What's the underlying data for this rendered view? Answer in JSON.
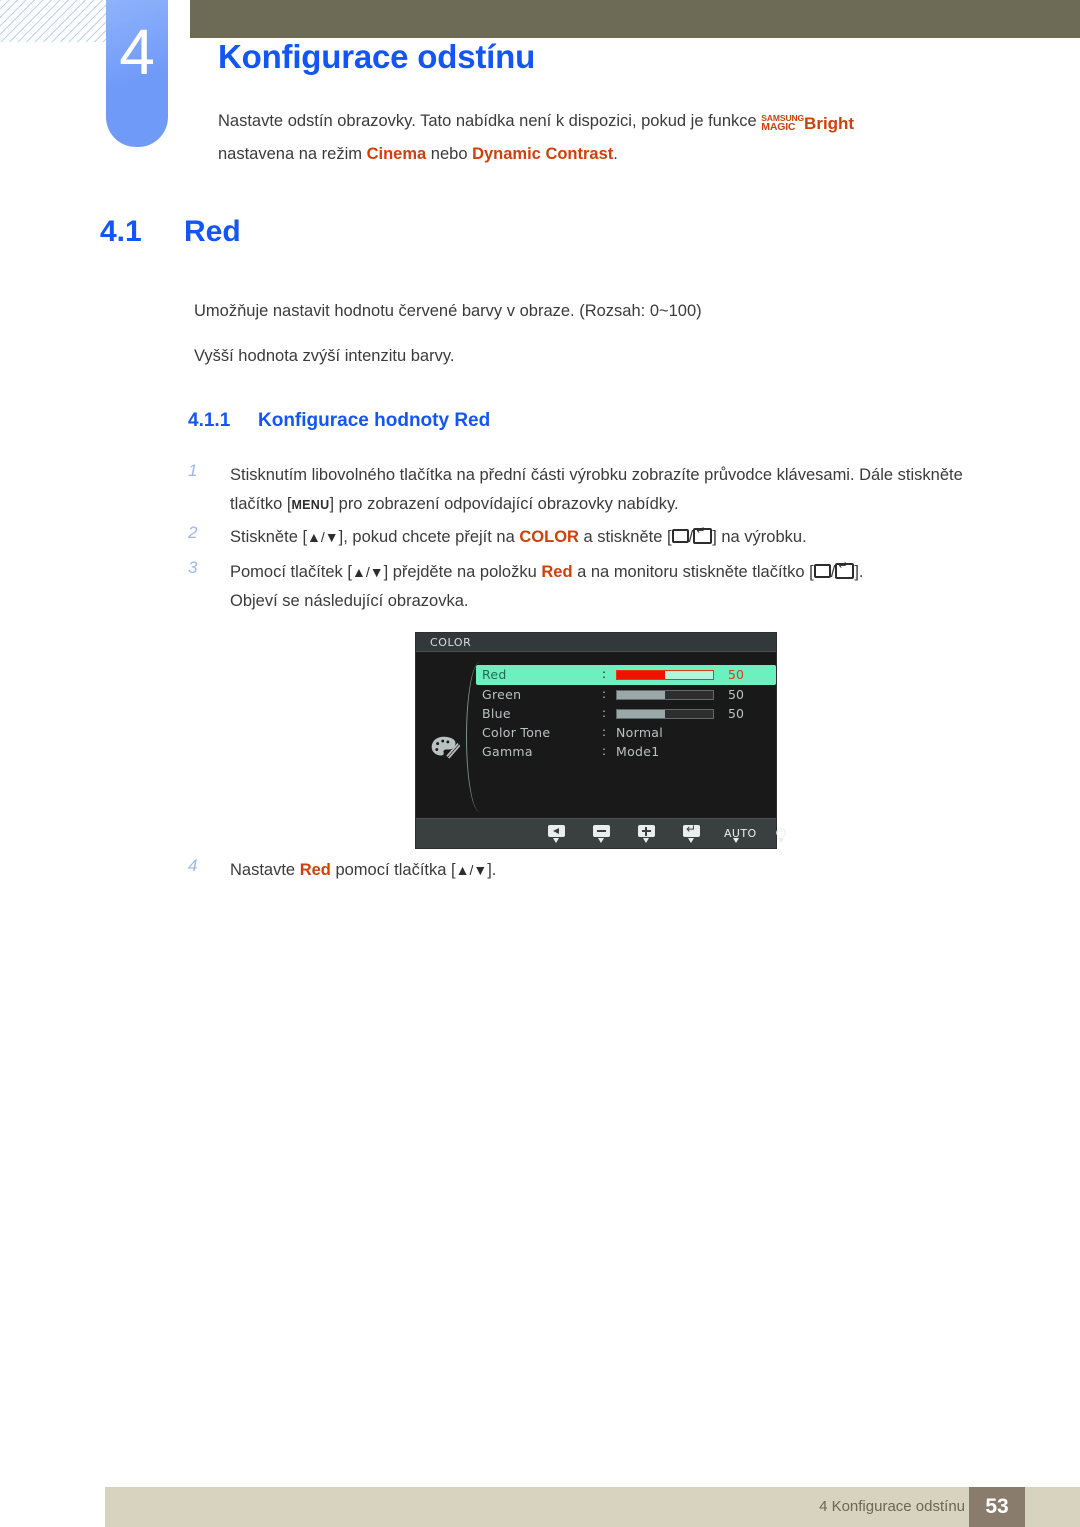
{
  "header": {
    "chapter_number": "4",
    "chapter_title": "Konfigurace odstínu",
    "intro_part1": "Nastavte odstín obrazovky. Tato nabídka není k dispozici, pokud je funkce ",
    "magic_top": "SAMSUNG",
    "magic_bottom": "MAGIC",
    "magic_bright": "Bright",
    "intro_part2": "nastavena na režim ",
    "intro_mode1": "Cinema",
    "intro_part3": " nebo ",
    "intro_mode2": "Dynamic Contrast",
    "intro_part4": "."
  },
  "section": {
    "number": "4.1",
    "title": "Red",
    "para_range": "Umožňuje nastavit hodnotu červené barvy v obraze. (Rozsah: 0~100)",
    "para_higher": "Vyšší hodnota zvýší intenzitu barvy."
  },
  "subsection": {
    "number": "4.1.1",
    "title": "Konfigurace hodnoty Red"
  },
  "steps": [
    {
      "num": "1",
      "t1": "Stisknutím libovolného tlačítka na přední části výrobku zobrazíte průvodce klávesami. Dále stiskněte tlačítko [",
      "key": "MENU",
      "t2": "] pro zobrazení odpovídající obrazovky nabídky."
    },
    {
      "num": "2",
      "t1": "Stiskněte [",
      "keys1": "▲/▼",
      "t2": "], pokud chcete přejít na ",
      "hl": "COLOR",
      "t3": " a stiskněte [",
      "t4": "] na výrobku."
    },
    {
      "num": "3",
      "t1": "Pomocí tlačítek [",
      "keys1": "▲/▼",
      "t2": "] přejděte na položku ",
      "hl": "Red",
      "t3": " a na monitoru stiskněte tlačítko [",
      "t4": "].",
      "sub": "Objeví se následující obrazovka."
    },
    {
      "num": "4",
      "t1": "Nastavte ",
      "hl": "Red",
      "t2": " pomocí tlačítka [",
      "keys1": "▲/▼",
      "t3": "]."
    }
  ],
  "osd": {
    "title": "COLOR",
    "rows": [
      {
        "label": "Red",
        "colon": ":",
        "type": "slider",
        "fill": 50,
        "value": "50",
        "selected": true
      },
      {
        "label": "Green",
        "colon": ":",
        "type": "slider",
        "fill": 50,
        "value": "50",
        "selected": false
      },
      {
        "label": "Blue",
        "colon": ":",
        "type": "slider",
        "fill": 50,
        "value": "50",
        "selected": false
      },
      {
        "label": "Color Tone",
        "colon": ":",
        "type": "text",
        "value": "Normal",
        "selected": false
      },
      {
        "label": "Gamma",
        "colon": ":",
        "type": "text",
        "value": "Mode1",
        "selected": false
      }
    ],
    "buttons": [
      {
        "icon": "back-icon",
        "label": ""
      },
      {
        "icon": "minus-icon",
        "label": ""
      },
      {
        "icon": "plus-icon",
        "label": ""
      },
      {
        "icon": "enter-icon",
        "label": ""
      },
      {
        "icon": "auto-label",
        "label": "AUTO"
      },
      {
        "icon": "power-icon",
        "label": "⏻"
      }
    ],
    "colors": {
      "highlight": "#6cf0c0",
      "red_fill": "#ef1200",
      "panel": "#191919",
      "titlebar": "#33393a",
      "footer": "#3a3f40"
    }
  },
  "footer": {
    "text": "4 Konfigurace odstínu",
    "page": "53"
  },
  "theme": {
    "heading_blue": "#1355f5",
    "accent_orange": "#d0400b",
    "olive": "#6d6b56",
    "tab_blue": "#6f9af8",
    "footer_bg": "#d8d3bf",
    "page_box": "#8a7c6d"
  }
}
